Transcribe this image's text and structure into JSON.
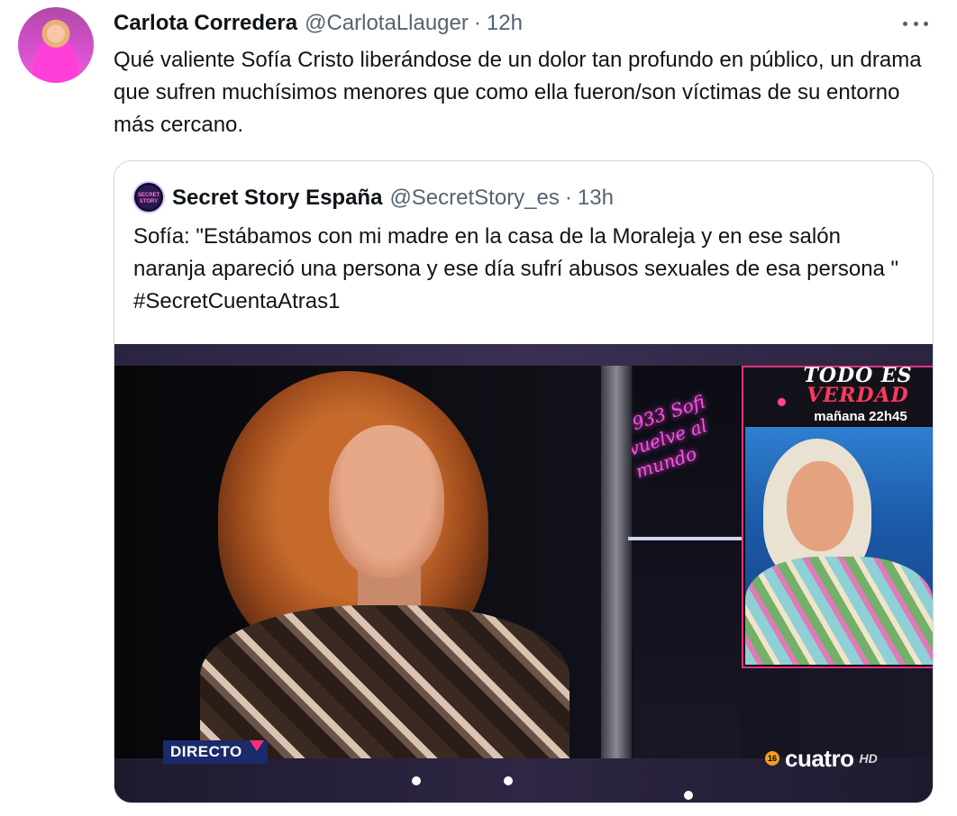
{
  "tweet": {
    "author_name": "Carlota Corredera",
    "author_handle": "@CarlotaLlauger",
    "separator": "·",
    "time": "12h",
    "text": "Qué valiente Sofía Cristo liberándose de un dolor tan profundo en público, un drama que sufren muchísimos menores que como ella fueron/son víctimas de su entorno más cercano.",
    "more_icon": "more-horizontal-icon"
  },
  "quoted_tweet": {
    "author_name": "Secret Story España",
    "author_handle": "@SecretStory_es",
    "separator": "·",
    "time": "13h",
    "avatar_label": "SECRET STORY",
    "text": "Sofía: \"Estábamos con mi madre en la casa de la Moraleja y en ese salón naranja apareció una persona y ese día sufrí abusos sexuales de esa persona \" #SecretCuentaAtras1",
    "media": {
      "live_badge": "DIRECTO",
      "pip_title_line1": "TODO ES",
      "pip_title_line2": "VERDAD",
      "pip_time": "mañana 22h45",
      "neon_text": "1933 Sofi vuelve al mundo",
      "age_rating": "16",
      "channel_name": "cuatro",
      "channel_suffix": "HD"
    }
  },
  "colors": {
    "text_primary": "#0f1419",
    "text_secondary": "#536471",
    "border": "#cfd9de",
    "live_badge_bg": "#1a2a6a",
    "accent_pink": "#ff2e7a"
  }
}
